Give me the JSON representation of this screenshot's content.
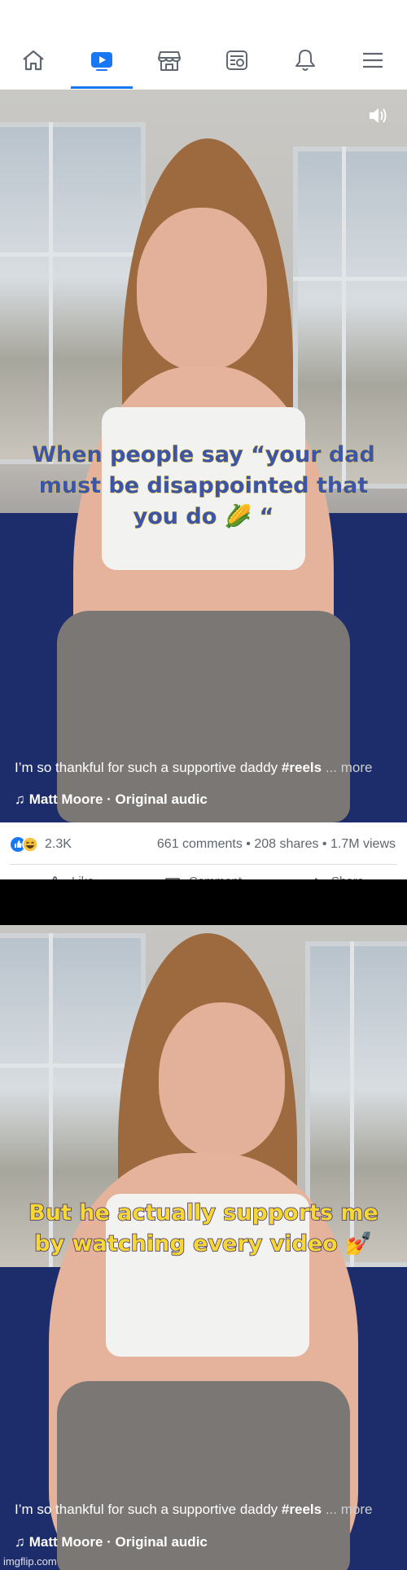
{
  "nav": {
    "items": [
      {
        "icon": "home-icon",
        "active": false
      },
      {
        "icon": "watch-video-icon",
        "active": true
      },
      {
        "icon": "marketplace-icon",
        "active": false
      },
      {
        "icon": "news-feed-icon",
        "active": false
      },
      {
        "icon": "notifications-bell-icon",
        "active": false
      },
      {
        "icon": "menu-icon",
        "active": false
      }
    ],
    "active_color": "#1877f2"
  },
  "reel1": {
    "overlay_lines": [
      "When people say “your dad",
      "must be disappointed that",
      "you do 🌽 “"
    ],
    "caption": "I’m so thankful for such a supportive daddy",
    "hashtag": "#reels",
    "more": "... more",
    "audio": "Matt Moore · Original audic",
    "sound_icon": "speaker-on-icon"
  },
  "stats": {
    "reaction_count": "2.3K",
    "comments_shares_views": "661 comments • 208 shares • 1.7M views",
    "actions": [
      "Like",
      "Comment",
      "Share"
    ]
  },
  "reel2": {
    "overlay_lines": [
      "But he actually supports me",
      "by watching every video 💅"
    ],
    "caption": "I’m so thankful for such a supportive daddy",
    "hashtag": "#reels",
    "more": "... more",
    "audio": "Matt Moore · Original audic"
  },
  "watermark": "imgflip.com"
}
